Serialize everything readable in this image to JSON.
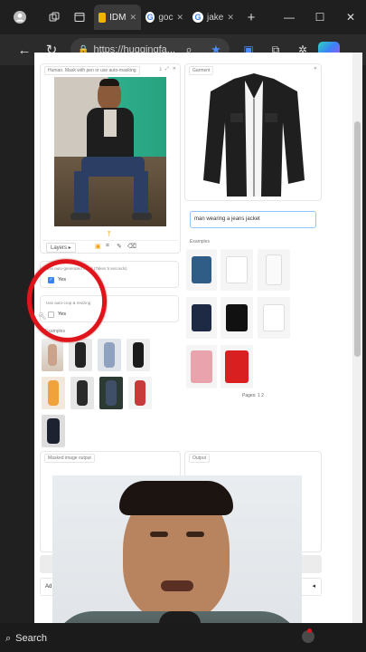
{
  "browser": {
    "tabs": [
      {
        "label": "IDM",
        "icon": "idm-icon"
      },
      {
        "label": "goc",
        "icon": "google-icon"
      },
      {
        "label": "jake",
        "icon": "google-icon"
      }
    ],
    "new_tab_label": "+",
    "url": "https://huggingfa..."
  },
  "app": {
    "human_panel_label": "Human. Mask with pen or use auto-masking",
    "garment_panel_label": "Garment",
    "garment_description": "man wearing a jeans jacket",
    "layers_label": "Layers",
    "auto_mask_label": "Use auto-generated mask (Takes 5 seconds)",
    "auto_mask_checked_label": "Yes",
    "auto_crop_label": "Use auto-crop & resizing",
    "auto_crop_label_value": "Yes",
    "examples_label": "Examples",
    "garment_examples_label": "Examples",
    "pages_label": "Pages: 1 2",
    "masked_output_label": "Masked image output",
    "output_label": "Output",
    "advanced_label": "Ad"
  },
  "taskbar": {
    "search_label": "Search"
  },
  "colors": {
    "annotation_circle": "#e0151b",
    "accent_blue": "#3b82f6"
  }
}
